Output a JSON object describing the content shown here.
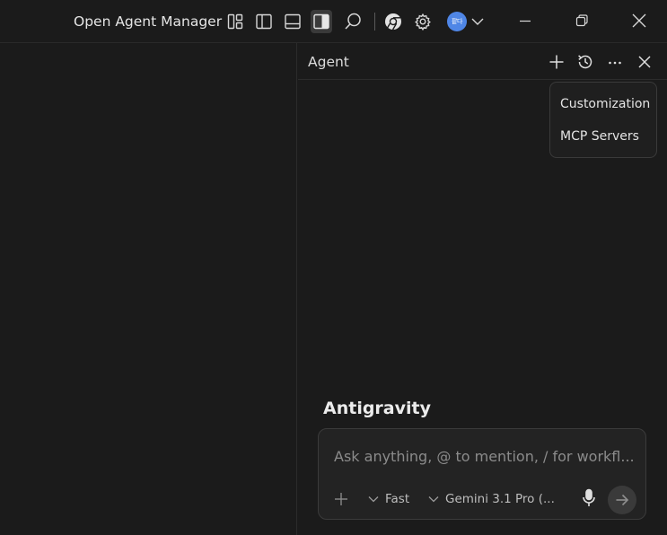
{
  "titlebar": {
    "open_agent_manager_label": "Open Agent Manager",
    "avatar_text": "팥다",
    "icons": [
      "customize-layout-icon",
      "toggle-primary-sidebar-icon",
      "toggle-panel-icon",
      "toggle-secondary-sidebar-icon",
      "search-icon",
      "chrome-icon",
      "settings-gear-icon",
      "chevron-down-icon",
      "minimize-icon",
      "restore-icon",
      "close-icon"
    ]
  },
  "agent_panel": {
    "title": "Agent",
    "header_icons": [
      "new-chat-icon",
      "history-icon",
      "more-icon",
      "close-icon"
    ],
    "menu": {
      "items": [
        {
          "label": "Customization"
        },
        {
          "label": "MCP Servers"
        }
      ]
    },
    "brand": "Antigravity",
    "chat": {
      "placeholder": "Ask anything, @ to mention, / for workfl...",
      "mode_label": "Fast",
      "model_label": "Gemini 3.1 Pro (..."
    }
  },
  "colors": {
    "background": "#1b1b1b",
    "avatar": "#4f86e6",
    "border": "#3b3b3b"
  }
}
